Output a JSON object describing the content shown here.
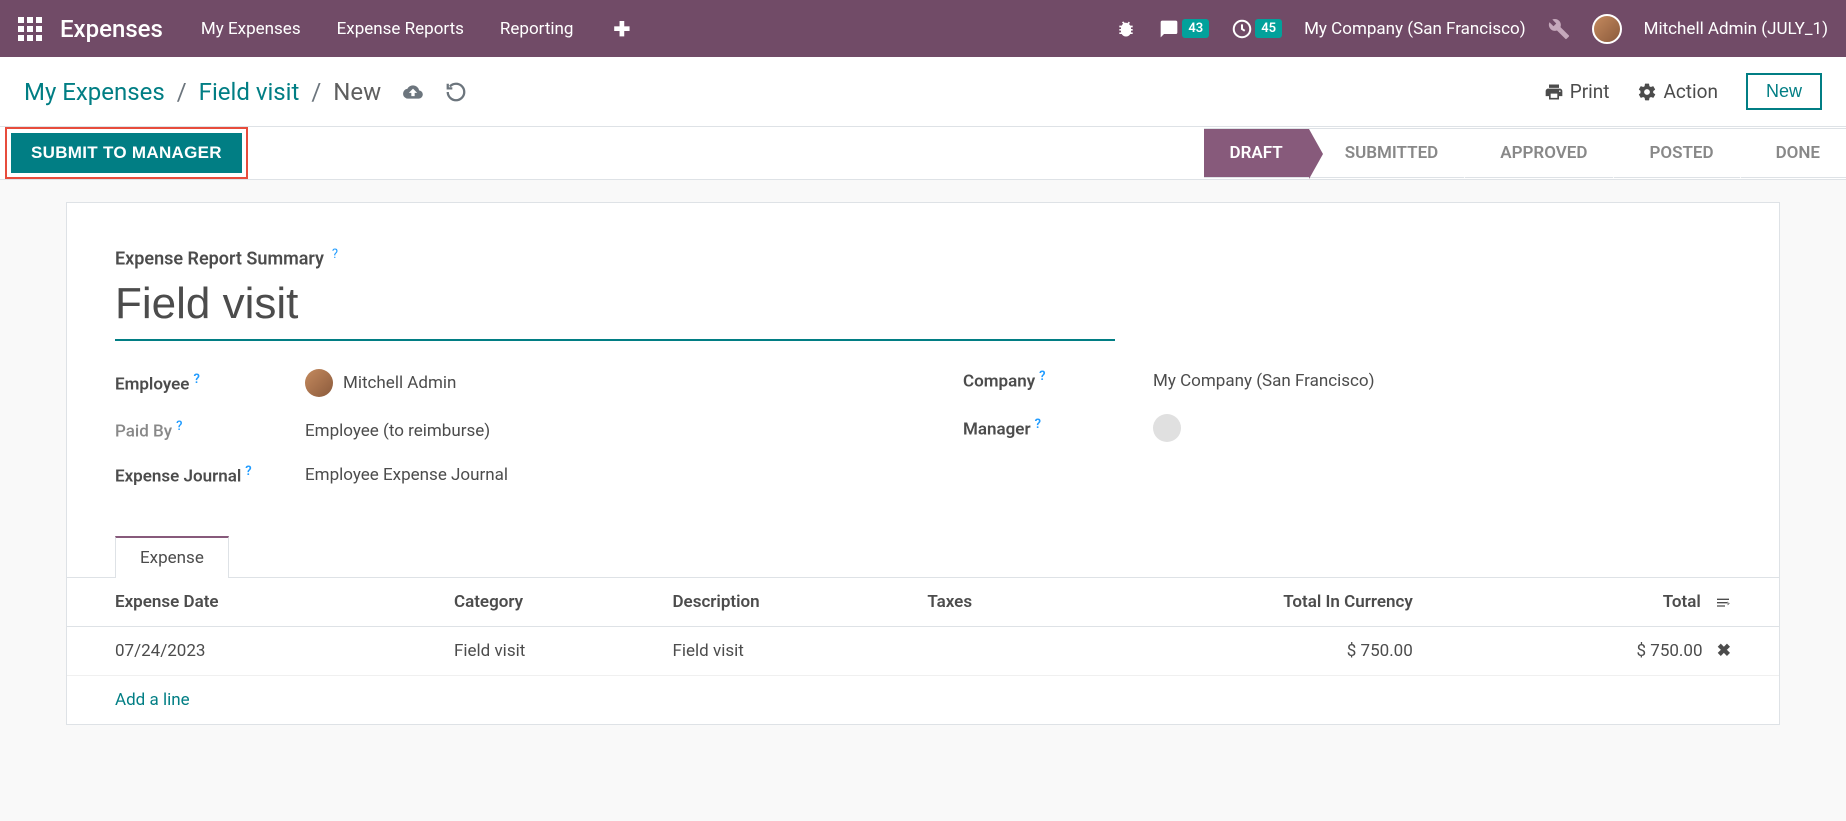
{
  "topbar": {
    "app_title": "Expenses",
    "nav": [
      "My Expenses",
      "Expense Reports",
      "Reporting"
    ],
    "msg_count": "43",
    "activity_count": "45",
    "company": "My Company (San Francisco)",
    "user": "Mitchell Admin (JULY_1)"
  },
  "breadcrumbs": {
    "items": [
      "My Expenses",
      "Field visit",
      "New"
    ]
  },
  "subbar": {
    "print": "Print",
    "action": "Action",
    "new": "New"
  },
  "actionbar": {
    "submit": "SUBMIT TO MANAGER",
    "statuses": [
      "DRAFT",
      "SUBMITTED",
      "APPROVED",
      "POSTED",
      "DONE"
    ]
  },
  "form": {
    "summary_label": "Expense Report Summary",
    "title": "Field visit",
    "labels": {
      "employee": "Employee",
      "paid_by": "Paid By",
      "journal": "Expense Journal",
      "company": "Company",
      "manager": "Manager"
    },
    "values": {
      "employee": "Mitchell Admin",
      "paid_by": "Employee (to reimburse)",
      "journal": "Employee Expense Journal",
      "company": "My Company (San Francisco)"
    }
  },
  "tab": "Expense",
  "table": {
    "headers": {
      "date": "Expense Date",
      "category": "Category",
      "description": "Description",
      "taxes": "Taxes",
      "total_currency": "Total In Currency",
      "total": "Total"
    },
    "row": {
      "date": "07/24/2023",
      "category": "Field visit",
      "description": "Field visit",
      "total_currency": "$ 750.00",
      "total": "$ 750.00"
    },
    "add_line": "Add a line"
  }
}
